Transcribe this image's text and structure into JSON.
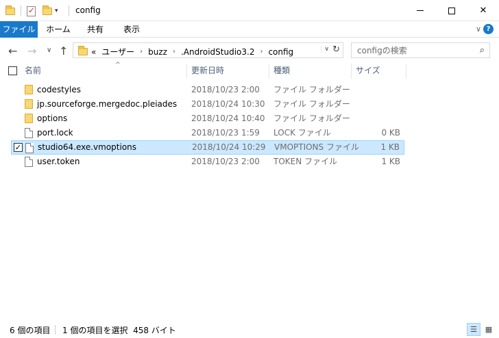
{
  "window": {
    "title": "config",
    "minimize_icon": "minimize-icon",
    "maximize_icon": "maximize-icon",
    "close_glyph": "✕"
  },
  "ribbon": {
    "tabs": [
      {
        "label": "ファイル",
        "active": true
      },
      {
        "label": "ホーム"
      },
      {
        "label": "共有"
      },
      {
        "label": "表示"
      }
    ],
    "expand_glyph": "∨",
    "help_glyph": "?"
  },
  "nav": {
    "back_glyph": "←",
    "forward_glyph": "→",
    "recent_glyph": "∨",
    "up_glyph": "↑",
    "breadcrumb": {
      "overflow": "«",
      "parts": [
        "ユーザー",
        "buzz",
        ".AndroidStudio3.2",
        "config"
      ],
      "sep": "›"
    },
    "refresh_glyph": "↻",
    "dropdown_glyph": "∨"
  },
  "search": {
    "placeholder": "configの検索",
    "icon_glyph": "⌕"
  },
  "columns": {
    "name": "名前",
    "date": "更新日時",
    "type": "種類",
    "size": "サイズ",
    "sort_glyph": "^"
  },
  "files": [
    {
      "name": "codestyles",
      "date": "2018/10/23 2:00",
      "type": "ファイル フォルダー",
      "size": "",
      "kind": "folder"
    },
    {
      "name": "jp.sourceforge.mergedoc.pleiades",
      "date": "2018/10/24 10:30",
      "type": "ファイル フォルダー",
      "size": "",
      "kind": "folder"
    },
    {
      "name": "options",
      "date": "2018/10/24 10:40",
      "type": "ファイル フォルダー",
      "size": "",
      "kind": "folder"
    },
    {
      "name": "port.lock",
      "date": "2018/10/23 1:59",
      "type": "LOCK ファイル",
      "size": "0 KB",
      "kind": "file"
    },
    {
      "name": "studio64.exe.vmoptions",
      "date": "2018/10/24 10:29",
      "type": "VMOPTIONS ファイル",
      "size": "1 KB",
      "kind": "file",
      "selected": true
    },
    {
      "name": "user.token",
      "date": "2018/10/23 2:00",
      "type": "TOKEN ファイル",
      "size": "1 KB",
      "kind": "file"
    }
  ],
  "status": {
    "item_count": "6 個の項目",
    "selection": "1 個の項目を選択  458 バイト",
    "details_view_glyph": "☰",
    "tiles_view_glyph": "▦"
  },
  "colors": {
    "accent": "#1979ca",
    "selection_bg": "#cce8ff",
    "selection_border": "#99d1ff",
    "folder": "#f8d775",
    "header_text": "#4c607a",
    "secondary_text": "#6d6d6d"
  }
}
